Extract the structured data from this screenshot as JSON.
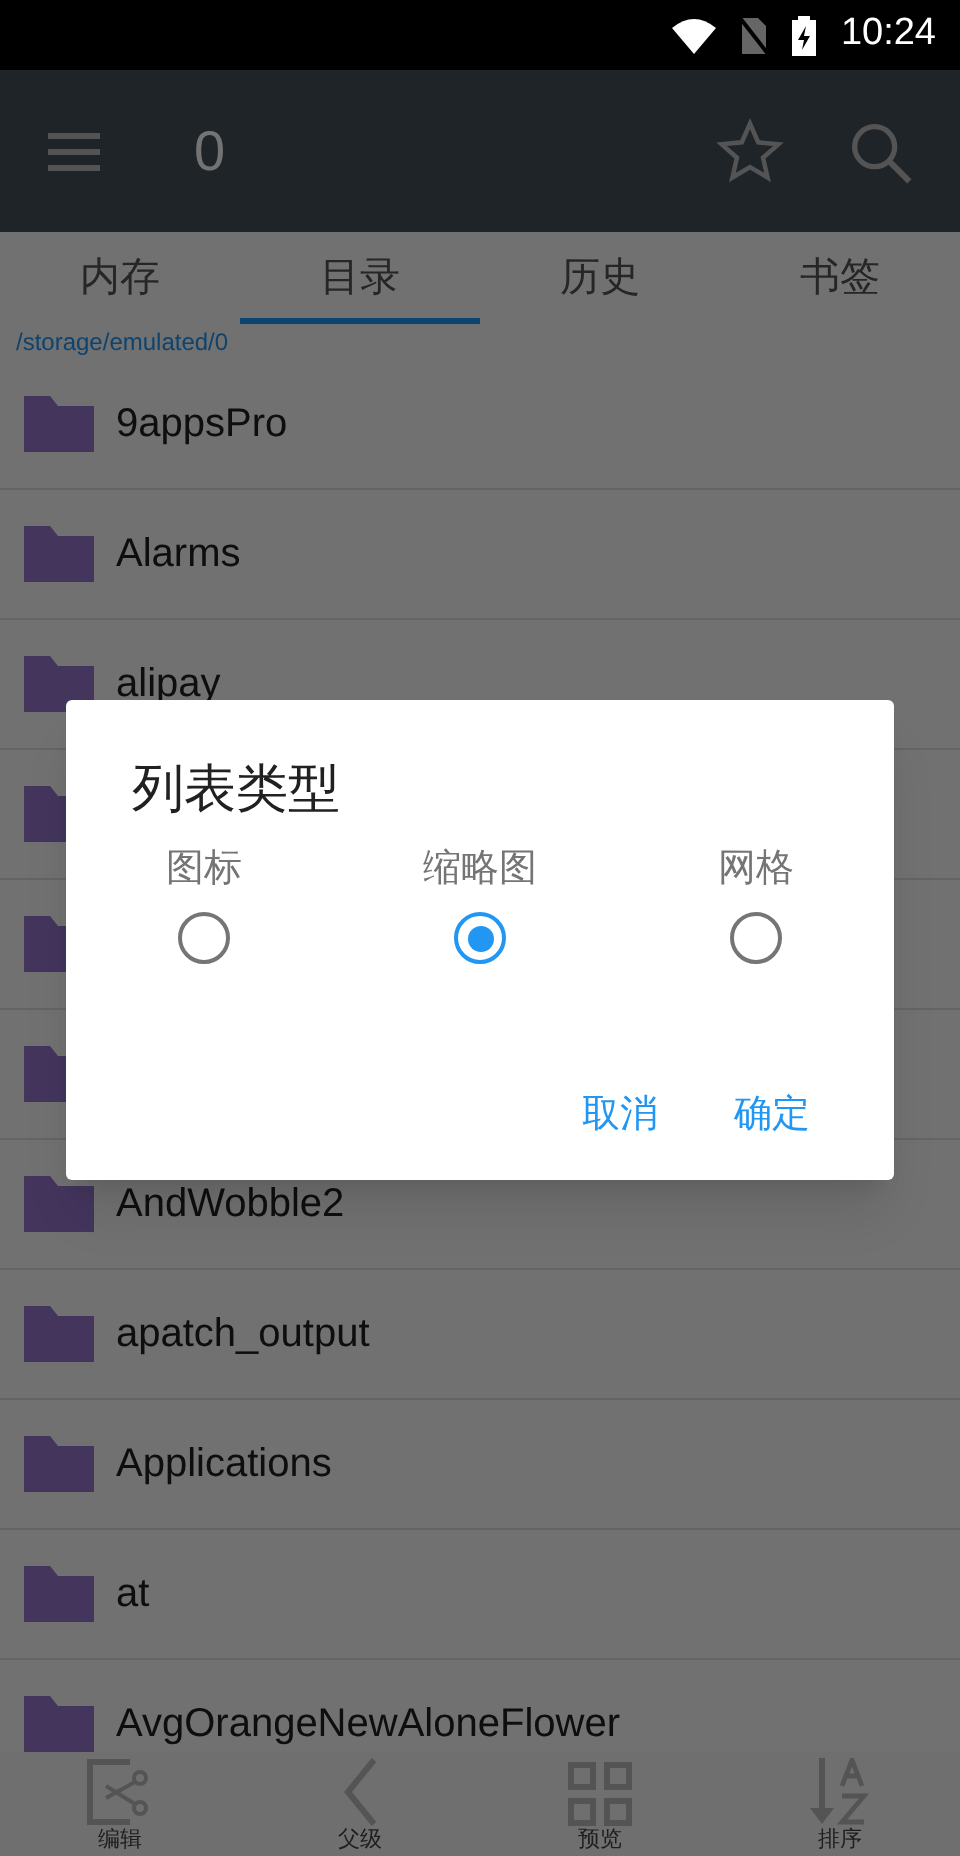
{
  "status_bar": {
    "time": "10:24"
  },
  "toolbar": {
    "title": "0"
  },
  "tabs": [
    {
      "label": "内存",
      "selected": false
    },
    {
      "label": "目录",
      "selected": true
    },
    {
      "label": "历史",
      "selected": false
    },
    {
      "label": "书签",
      "selected": false
    }
  ],
  "path": "/storage/emulated/0",
  "folders": [
    {
      "name": "9appsPro"
    },
    {
      "name": "Alarms"
    },
    {
      "name": "alipay"
    },
    {
      "kind": "folder"
    },
    {
      "kind": "folder"
    },
    {
      "kind": "folder"
    },
    {
      "name": "AndWobble2"
    },
    {
      "name": "apatch_output"
    },
    {
      "name": "Applications"
    },
    {
      "name": "at"
    },
    {
      "name": "AvgOrangeNewAloneFlower"
    }
  ],
  "dialog": {
    "title": "列表类型",
    "options": [
      {
        "label": "图标",
        "selected": false
      },
      {
        "label": "缩略图",
        "selected": true
      },
      {
        "label": "网格",
        "selected": false
      }
    ],
    "buttons": [
      "取消",
      "确定"
    ]
  },
  "bottom_bar": [
    {
      "kind": "edit",
      "label": "编辑"
    },
    {
      "kind": "parent",
      "label": "父级"
    },
    {
      "kind": "preview",
      "label": "预览"
    },
    {
      "kind": "sort",
      "label": "排序"
    }
  ]
}
